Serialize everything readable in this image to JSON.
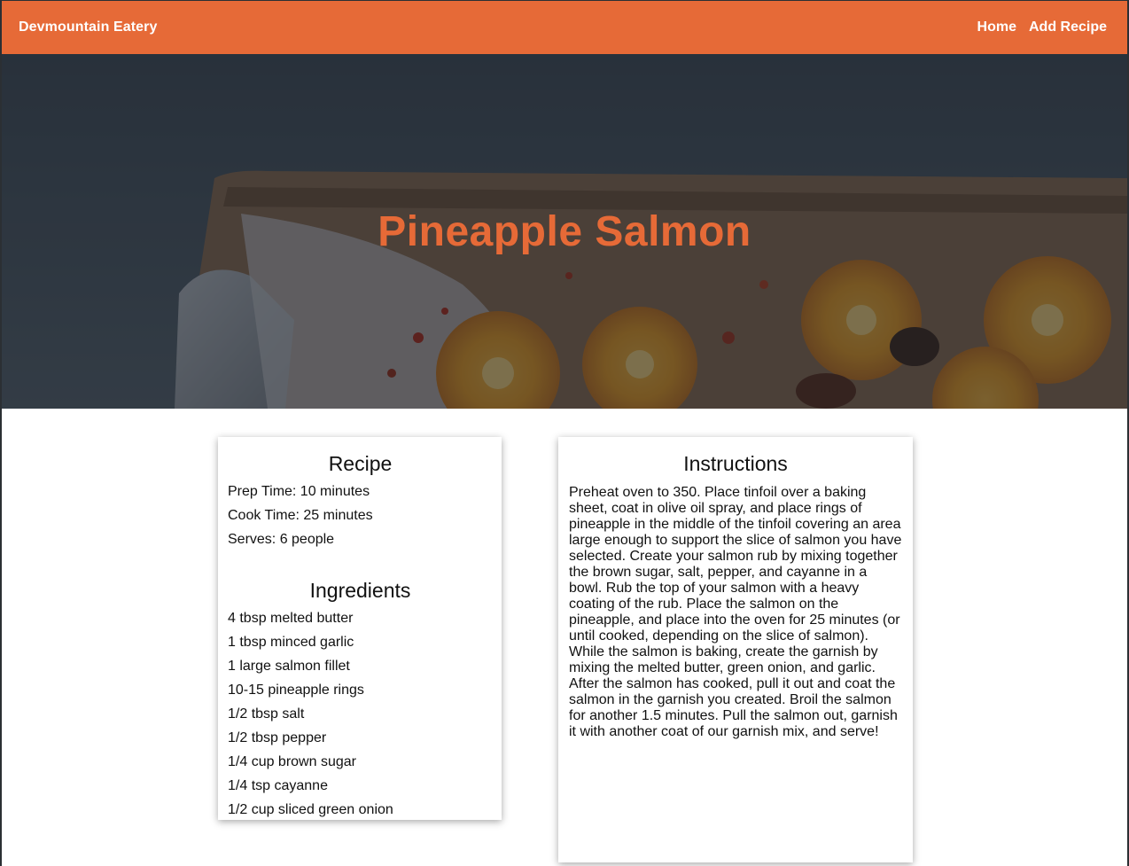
{
  "navbar": {
    "brand": "Devmountain Eatery",
    "links": [
      "Home",
      "Add Recipe"
    ]
  },
  "hero": {
    "title": "Pineapple Salmon"
  },
  "recipe": {
    "heading": "Recipe",
    "prep_time": "Prep Time: 10 minutes",
    "cook_time": "Cook Time: 25 minutes",
    "serves": "Serves: 6 people"
  },
  "ingredients": {
    "heading": "Ingredients",
    "items": [
      "4 tbsp melted butter",
      "1 tbsp minced garlic",
      "1 large salmon fillet",
      "10-15 pineapple rings",
      "1/2 tbsp salt",
      "1/2 tbsp pepper",
      "1/4 cup brown sugar",
      "1/4 tsp cayanne",
      "1/2 cup sliced green onion"
    ]
  },
  "instructions": {
    "heading": "Instructions",
    "text": "Preheat oven to 350. Place tinfoil over a baking sheet, coat in olive oil spray, and place rings of pineapple in the middle of the tinfoil covering an area large enough to support the slice of salmon you have selected. Create your salmon rub by mixing together the brown sugar, salt, pepper, and cayanne in a bowl. Rub the top of your salmon with a heavy coating of the rub. Place the salmon on the pineapple, and place into the oven for 25 minutes (or until cooked, depending on the slice of salmon). While the salmon is baking, create the garnish by mixing the melted butter, green onion, and garlic. After the salmon has cooked, pull it out and coat the salmon in the garnish you created. Broil the salmon for another 1.5 minutes. Pull the salmon out, garnish it with another coat of our garnish mix, and serve!"
  },
  "colors": {
    "accent": "#e66a37",
    "hero_overlay": "#181e26",
    "card_background": "#ffffff"
  }
}
